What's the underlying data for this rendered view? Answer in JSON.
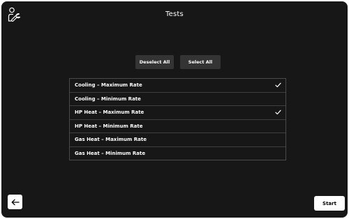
{
  "header": {
    "title": "Tests",
    "user_icon": "technician-icon"
  },
  "actions": {
    "deselect_all_label": "Deselect All",
    "select_all_label": "Select All"
  },
  "tests": [
    {
      "label": "Cooling – Maximum Rate",
      "checked": true
    },
    {
      "label": "Cooling – Minimum Rate",
      "checked": false
    },
    {
      "label": "HP Heat – Maximum Rate",
      "checked": true
    },
    {
      "label": "HP Heat – Minimum Rate",
      "checked": false
    },
    {
      "label": "Gas Heat – Maximum Rate",
      "checked": false
    },
    {
      "label": "Gas Heat – Minimum Rate",
      "checked": false
    }
  ],
  "footer": {
    "back_icon": "arrow-left-icon",
    "start_label": "Start"
  },
  "colors": {
    "background": "#171717",
    "button": "#343434",
    "list_border": "#4a4a4a",
    "text": "#ffffff"
  }
}
